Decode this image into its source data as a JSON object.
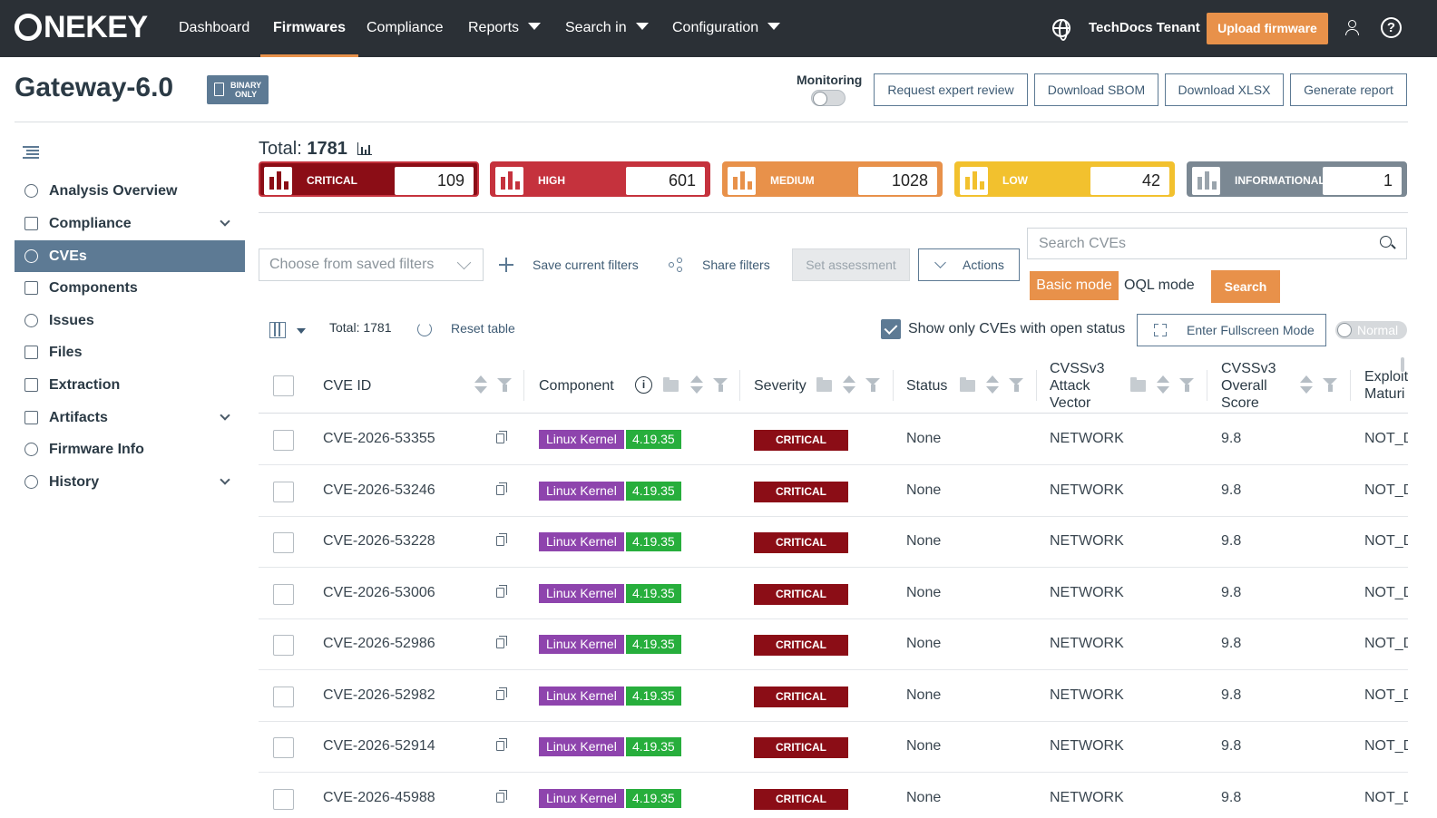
{
  "nav": {
    "logo": "NEKEY",
    "items": [
      "Dashboard",
      "Firmwares",
      "Compliance",
      "Reports",
      "Search in",
      "Configuration"
    ],
    "active": "Firmwares",
    "tenant": "TechDocs Tenant",
    "upload_label": "Upload firmware",
    "help_glyph": "?"
  },
  "header": {
    "title": "Gateway-6.0",
    "badge_line1": "BINARY",
    "badge_line2": "ONLY",
    "monitoring_label": "Monitoring",
    "buttons": [
      "Request expert review",
      "Download SBOM",
      "Download XLSX",
      "Generate report"
    ]
  },
  "sidebar": {
    "items": [
      {
        "label": "Analysis Overview",
        "icon": "gauge-icon",
        "expand": false
      },
      {
        "label": "Compliance",
        "icon": "shield-icon",
        "expand": true
      },
      {
        "label": "CVEs",
        "icon": "bug-icon",
        "expand": false,
        "active": true
      },
      {
        "label": "Components",
        "icon": "grid-icon",
        "expand": false
      },
      {
        "label": "Issues",
        "icon": "alert-icon",
        "expand": false
      },
      {
        "label": "Files",
        "icon": "file-icon",
        "expand": false
      },
      {
        "label": "Extraction",
        "icon": "folder-open-icon",
        "expand": false
      },
      {
        "label": "Artifacts",
        "icon": "artifact-icon",
        "expand": true
      },
      {
        "label": "Firmware Info",
        "icon": "info-icon",
        "expand": false
      },
      {
        "label": "History",
        "icon": "clock-icon",
        "expand": true
      }
    ]
  },
  "summary": {
    "total_label": "Total:",
    "total": "1781",
    "severities": [
      {
        "label": "CRITICAL",
        "count": "109",
        "color": "#8b0d16",
        "border": "#c5323d",
        "bars": "#8b0d16"
      },
      {
        "label": "HIGH",
        "count": "601",
        "color": "#c5323d",
        "border": "#c5323d",
        "bars": "#c5323d"
      },
      {
        "label": "MEDIUM",
        "count": "1028",
        "color": "#e8914a",
        "border": "#e8914a",
        "bars": "#e8914a"
      },
      {
        "label": "LOW",
        "count": "42",
        "color": "#f2c12e",
        "border": "#f2c12e",
        "bars": "#f2c12e"
      },
      {
        "label": "INFORMATIONAL",
        "count": "1",
        "color": "#7b8893",
        "border": "#7b8893",
        "bars": "#9aa4ac"
      }
    ]
  },
  "filters": {
    "saved_placeholder": "Choose from saved filters",
    "save_label": "Save current filters",
    "share_label": "Share filters",
    "set_assessment": "Set assessment",
    "actions": "Actions",
    "search_placeholder": "Search CVEs",
    "basic_mode": "Basic mode",
    "oql_mode": "OQL mode",
    "search_button": "Search"
  },
  "toolbar": {
    "total": "Total: 1781",
    "reset": "Reset table",
    "open_status": "Show only CVEs with open status",
    "fullscreen": "Enter Fullscreen Mode",
    "density": "Normal"
  },
  "table": {
    "columns": {
      "cve_id": "CVE ID",
      "component": "Component",
      "severity": "Severity",
      "status": "Status",
      "vector_1": "CVSSv3",
      "vector_2": "Attack",
      "vector_3": "Vector",
      "score_1": "CVSSv3",
      "score_2": "Overall",
      "score_3": "Score",
      "exploit_1": "Exploit",
      "exploit_2": "Maturi"
    },
    "rows": [
      {
        "cve": "CVE-2026-53355",
        "component": "Linux Kernel",
        "version": "4.19.35",
        "severity": "CRITICAL",
        "status": "None",
        "vector": "NETWORK",
        "score": "9.8",
        "exploit": "NOT_D"
      },
      {
        "cve": "CVE-2026-53246",
        "component": "Linux Kernel",
        "version": "4.19.35",
        "severity": "CRITICAL",
        "status": "None",
        "vector": "NETWORK",
        "score": "9.8",
        "exploit": "NOT_D"
      },
      {
        "cve": "CVE-2026-53228",
        "component": "Linux Kernel",
        "version": "4.19.35",
        "severity": "CRITICAL",
        "status": "None",
        "vector": "NETWORK",
        "score": "9.8",
        "exploit": "NOT_D"
      },
      {
        "cve": "CVE-2026-53006",
        "component": "Linux Kernel",
        "version": "4.19.35",
        "severity": "CRITICAL",
        "status": "None",
        "vector": "NETWORK",
        "score": "9.8",
        "exploit": "NOT_D"
      },
      {
        "cve": "CVE-2026-52986",
        "component": "Linux Kernel",
        "version": "4.19.35",
        "severity": "CRITICAL",
        "status": "None",
        "vector": "NETWORK",
        "score": "9.8",
        "exploit": "NOT_D"
      },
      {
        "cve": "CVE-2026-52982",
        "component": "Linux Kernel",
        "version": "4.19.35",
        "severity": "CRITICAL",
        "status": "None",
        "vector": "NETWORK",
        "score": "9.8",
        "exploit": "NOT_D"
      },
      {
        "cve": "CVE-2026-52914",
        "component": "Linux Kernel",
        "version": "4.19.35",
        "severity": "CRITICAL",
        "status": "None",
        "vector": "NETWORK",
        "score": "9.8",
        "exploit": "NOT_D"
      },
      {
        "cve": "CVE-2026-45988",
        "component": "Linux Kernel",
        "version": "4.19.35",
        "severity": "CRITICAL",
        "status": "None",
        "vector": "NETWORK",
        "score": "9.8",
        "exploit": "NOT_D"
      }
    ]
  }
}
